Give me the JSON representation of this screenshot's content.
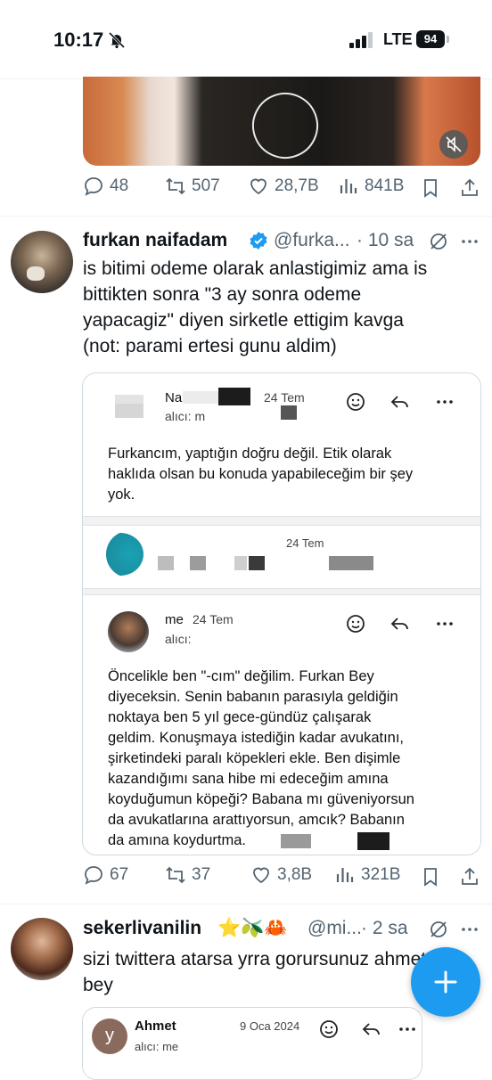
{
  "status_bar": {
    "time": "10:17",
    "network": "LTE",
    "battery": "94"
  },
  "tweet0": {
    "actions": {
      "reply": "48",
      "retweet": "507",
      "like": "28,7B",
      "views": "841B"
    }
  },
  "tweet1": {
    "name": "furkan naifadam",
    "handle": "@furka...",
    "time": "· 10 sa",
    "text": "is bitimi odeme olarak anlastigimiz ama is\nbittikten sonra \"3 ay sonra odeme\nyapacagiz\" diyen sirketle ettigim kavga\n(not: parami ertesi gunu aldim)",
    "email1": {
      "sender": "Na",
      "date": "24 Tem",
      "to": "alıcı: m",
      "body": "Furkancım, yaptığın doğru değil. Etik olarak\nhaklıda olsan bu konuda yapabileceğim bir şey\nyok."
    },
    "email2": {
      "date": "24 Tem"
    },
    "email3": {
      "sender": "me",
      "date": "24 Tem",
      "to": "alıcı:",
      "body": "Öncelikle ben \"-cım\" değilim. Furkan Bey\ndiyeceksin. Senin babanın parasıyla geldiğin\nnoktaya ben 5 yıl gece-gündüz çalışarak\ngeldim. Konuşmaya istediğin kadar avukatını,\nşirketindeki paralı köpekleri ekle. Ben dişimle\nkazandığımı sana hibe mi edeceğim amına\nkoyduğumun köpeği? Babana mı güveniyorsun\nda avukatlarına arattıyorsun, amcık? Babanın\nda amına koydurtma."
    },
    "actions": {
      "reply": "67",
      "retweet": "37",
      "like": "3,8B",
      "views": "321B"
    }
  },
  "tweet2": {
    "name": "sekerlivanilin",
    "emojis": "⭐🫒🦀",
    "handle": "@mi...",
    "time": "· 2 sa",
    "text": "sizi twittera atarsa yrra gorursunuz ahmet\nbey",
    "email": {
      "sender": "Ahmet",
      "date": "9 Oca 2024",
      "to": "alıcı: me",
      "avatar_letter": "y"
    }
  },
  "colors": {
    "accent": "#1d9bf0",
    "muted": "#536471",
    "text": "#0f1419"
  }
}
